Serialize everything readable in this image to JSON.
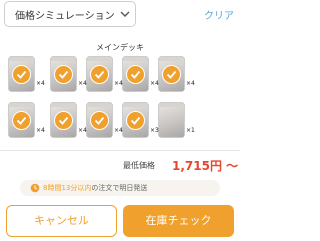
{
  "header": {
    "select_label": "価格シミュレーション",
    "clear_label": "クリア"
  },
  "deck": {
    "title": "メインデッキ",
    "cards": [
      {
        "count": "×4"
      },
      {
        "count": "×4"
      },
      {
        "count": "×4"
      },
      {
        "count": "×4"
      },
      {
        "count": "×4"
      },
      {
        "count": "×4"
      },
      {
        "count": "×4"
      },
      {
        "count": "×4"
      },
      {
        "count": "×3"
      },
      {
        "count": "×1"
      }
    ]
  },
  "price": {
    "label": "最低価格",
    "value": "1,715円 〜"
  },
  "notice": {
    "highlight": "8時間13分以内",
    "text": "の注文で明日発送"
  },
  "buttons": {
    "cancel": "キャンセル",
    "stock_check": "在庫チェック"
  },
  "colors": {
    "accent": "#f0a02c",
    "price": "#e8452e",
    "link": "#5aa7d6"
  }
}
